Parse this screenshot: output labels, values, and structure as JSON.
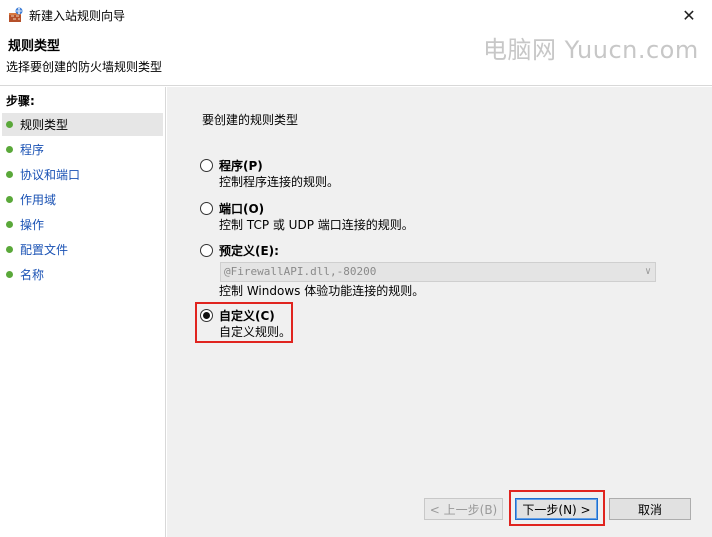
{
  "window": {
    "title": "新建入站规则向导",
    "close_glyph": "✕"
  },
  "header": {
    "title": "规则类型",
    "subtitle": "选择要创建的防火墙规则类型",
    "watermark": "电脑网 Yuucn.com"
  },
  "sidebar": {
    "title": "步骤:",
    "items": [
      {
        "label": "规则类型",
        "active": true
      },
      {
        "label": "程序"
      },
      {
        "label": "协议和端口"
      },
      {
        "label": "作用域"
      },
      {
        "label": "操作"
      },
      {
        "label": "配置文件"
      },
      {
        "label": "名称"
      }
    ]
  },
  "main": {
    "prompt": "要创建的规则类型",
    "options": [
      {
        "label": "程序(P)",
        "desc": "控制程序连接的规则。",
        "selected": false
      },
      {
        "label": "端口(O)",
        "desc": "控制 TCP 或 UDP 端口连接的规则。",
        "selected": false
      },
      {
        "label": "预定义(E):",
        "desc": "控制 Windows 体验功能连接的规则。",
        "selected": false
      },
      {
        "label": "自定义(C)",
        "desc": "自定义规则。",
        "selected": true
      }
    ],
    "predefined_select_value": "@FirewallAPI.dll,-80200"
  },
  "buttons": {
    "back": "< 上一步(B)",
    "next": "下一步(N) >",
    "cancel": "取消"
  },
  "colors": {
    "highlight": "#e0241f",
    "step_dot": "#5aa83a",
    "link": "#1a52b4"
  }
}
